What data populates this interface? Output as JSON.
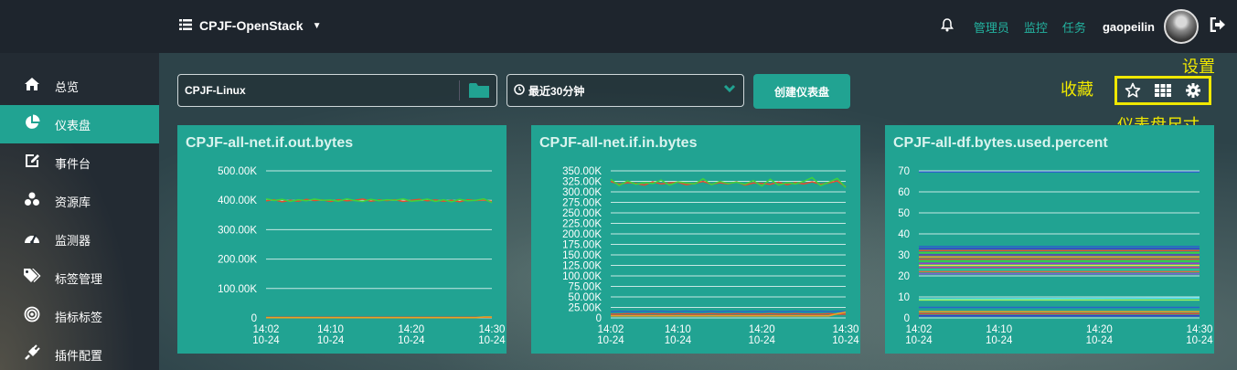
{
  "topbar": {
    "project": "CPJF-OpenStack",
    "links": [
      "管理员",
      "监控",
      "任务"
    ],
    "username": "gaopeilin",
    "icons": {
      "menu": "list-icon",
      "bell": "bell-icon",
      "logout": "logout-icon"
    }
  },
  "sidebar": {
    "items": [
      {
        "label": "总览",
        "icon": "home-icon"
      },
      {
        "label": "仪表盘",
        "icon": "pie-chart-icon",
        "active": true
      },
      {
        "label": "事件台",
        "icon": "edit-icon"
      },
      {
        "label": "资源库",
        "icon": "cubes-icon"
      },
      {
        "label": "监测器",
        "icon": "dashboard-icon"
      },
      {
        "label": "标签管理",
        "icon": "tags-icon"
      },
      {
        "label": "指标标签",
        "icon": "target-icon"
      },
      {
        "label": "插件配置",
        "icon": "plug-icon"
      }
    ]
  },
  "toolbar": {
    "host_select": "CPJF-Linux",
    "time_select": "最近30分钟",
    "create_button": "创建仪表盘"
  },
  "annotations": {
    "favorite": "收藏",
    "settings": "设置",
    "size": "仪表盘尺寸"
  },
  "colors": {
    "accent": "#21a392",
    "highlight": "#f0e800"
  },
  "chart_data": [
    {
      "type": "line",
      "title": "CPJF-all-net.if.out.bytes",
      "x_ticks": [
        "14:02\n10-24",
        "14:10\n10-24",
        "14:20\n10-24",
        "14:30\n10-24"
      ],
      "x_tick_minutes": [
        2,
        10,
        20,
        30
      ],
      "y_ticks": [
        "0",
        "100.00K",
        "200.00K",
        "300.00K",
        "400.00K",
        "500.00K"
      ],
      "ylim": [
        0,
        500
      ],
      "xlim": [
        2,
        30
      ],
      "series": [
        {
          "color": "#e84a2f",
          "values": [
            398,
            402,
            395,
            400,
            397,
            403,
            399,
            401,
            396,
            402,
            398,
            400,
            404,
            397,
            401,
            399,
            402,
            396,
            400,
            403,
            398,
            401,
            397,
            400,
            395,
            402,
            399,
            401,
            396
          ]
        },
        {
          "color": "#3fd43a",
          "values": [
            405,
            399,
            403,
            396,
            402,
            398,
            404,
            400,
            401,
            397,
            405,
            399,
            396,
            403,
            398,
            402,
            400,
            405,
            397,
            399,
            404,
            396,
            402,
            395,
            403,
            398,
            400,
            405,
            392
          ]
        },
        {
          "color": "#e84a2f",
          "values": [
            2,
            2,
            2,
            2,
            2,
            2,
            2,
            2,
            2,
            2,
            2,
            2,
            2,
            2,
            2,
            2,
            2,
            2,
            2,
            2,
            2,
            2,
            2,
            2,
            2,
            2,
            2,
            2,
            2
          ]
        },
        {
          "color": "#f0a020",
          "values": [
            1,
            1,
            1,
            1,
            1,
            1,
            1,
            1,
            1,
            1,
            1,
            1,
            1,
            1,
            1,
            1,
            1,
            1,
            1,
            1,
            1,
            1,
            1,
            1,
            1,
            1,
            1,
            3,
            3
          ]
        }
      ]
    },
    {
      "type": "line",
      "title": "CPJF-all-net.if.in.bytes",
      "x_ticks": [
        "14:02\n10-24",
        "14:10\n10-24",
        "14:20\n10-24",
        "14:30\n10-24"
      ],
      "x_tick_minutes": [
        2,
        10,
        20,
        30
      ],
      "y_ticks": [
        "0",
        "25.00K",
        "50.00K",
        "75.00K",
        "100.00K",
        "125.00K",
        "150.00K",
        "175.00K",
        "200.00K",
        "225.00K",
        "250.00K",
        "275.00K",
        "300.00K",
        "325.00K",
        "350.00K"
      ],
      "ylim": [
        0,
        350
      ],
      "xlim": [
        2,
        30
      ],
      "series": [
        {
          "color": "#e84a2f",
          "values": [
            325,
            318,
            322,
            320,
            316,
            324,
            319,
            321,
            323,
            317,
            320,
            325,
            318,
            322,
            319,
            324,
            316,
            321,
            320,
            318,
            323,
            317,
            322,
            319,
            324,
            318,
            321,
            326,
            312
          ]
        },
        {
          "color": "#3fd43a",
          "values": [
            330,
            315,
            326,
            318,
            322,
            320,
            328,
            316,
            324,
            321,
            319,
            331,
            317,
            325,
            320,
            323,
            318,
            327,
            314,
            330,
            316,
            322,
            319,
            325,
            334,
            315,
            323,
            332,
            310
          ]
        },
        {
          "color": "#2a64c8",
          "values": [
            15,
            16,
            15,
            15,
            16,
            15,
            16,
            15,
            15,
            16,
            15,
            15,
            16,
            15,
            16,
            15,
            15,
            16,
            15,
            16,
            15,
            15,
            16,
            15,
            15,
            16,
            15,
            16,
            15
          ]
        },
        {
          "color": "#e84a2f",
          "values": [
            9,
            9,
            10,
            9,
            9,
            10,
            9,
            9,
            10,
            9,
            9,
            9,
            10,
            9,
            9,
            10,
            9,
            9,
            9,
            10,
            9,
            9,
            10,
            9,
            9,
            9,
            10,
            9,
            9
          ]
        },
        {
          "color": "#f0a020",
          "values": [
            5,
            5,
            5,
            5,
            5,
            5,
            5,
            5,
            5,
            5,
            5,
            5,
            5,
            5,
            5,
            5,
            5,
            5,
            5,
            5,
            5,
            5,
            5,
            5,
            5,
            5,
            5,
            10,
            14
          ]
        }
      ]
    },
    {
      "type": "line",
      "title": "CPJF-all-df.bytes.used.percent",
      "x_ticks": [
        "14:02\n10-24",
        "14:10\n10-24",
        "14:20\n10-24",
        "14:30\n10-24"
      ],
      "x_tick_minutes": [
        2,
        10,
        20,
        30
      ],
      "y_ticks": [
        "0",
        "10",
        "20",
        "30",
        "40",
        "50",
        "60",
        "70"
      ],
      "ylim": [
        0,
        70
      ],
      "xlim": [
        2,
        30
      ],
      "series": [
        {
          "color": "#2a64c8",
          "values": [
            69.5,
            69.5
          ]
        },
        {
          "color": "#2a64c8",
          "values": [
            34,
            34
          ]
        },
        {
          "color": "#3a3ad0",
          "values": [
            33,
            33
          ]
        },
        {
          "color": "#e84a2f",
          "values": [
            32,
            32
          ]
        },
        {
          "color": "#3fd43a",
          "values": [
            31,
            31
          ]
        },
        {
          "color": "#6a3ab0",
          "values": [
            30,
            30
          ]
        },
        {
          "color": "#f0a020",
          "values": [
            29,
            29
          ]
        },
        {
          "color": "#e84a2f",
          "values": [
            28,
            28
          ]
        },
        {
          "color": "#3fd43a",
          "values": [
            27,
            27
          ]
        },
        {
          "color": "#9a40c0",
          "values": [
            26,
            26
          ]
        },
        {
          "color": "#f0e040",
          "values": [
            25,
            25
          ]
        },
        {
          "color": "#c0409a",
          "values": [
            24,
            24
          ]
        },
        {
          "color": "#2ad0a0",
          "values": [
            23,
            23
          ]
        },
        {
          "color": "#e07040",
          "values": [
            22,
            22
          ]
        },
        {
          "color": "#8060d0",
          "values": [
            21,
            21
          ]
        },
        {
          "color": "#50e0f0",
          "values": [
            9,
            9.5
          ]
        },
        {
          "color": "#a0f060",
          "values": [
            8.5,
            8.5
          ]
        },
        {
          "color": "#2a64c8",
          "values": [
            5,
            5
          ]
        },
        {
          "color": "#f0a020",
          "values": [
            3,
            3
          ]
        },
        {
          "color": "#e84a2f",
          "values": [
            2,
            2
          ]
        },
        {
          "color": "#3a3ad0",
          "values": [
            1,
            1
          ]
        }
      ]
    }
  ]
}
